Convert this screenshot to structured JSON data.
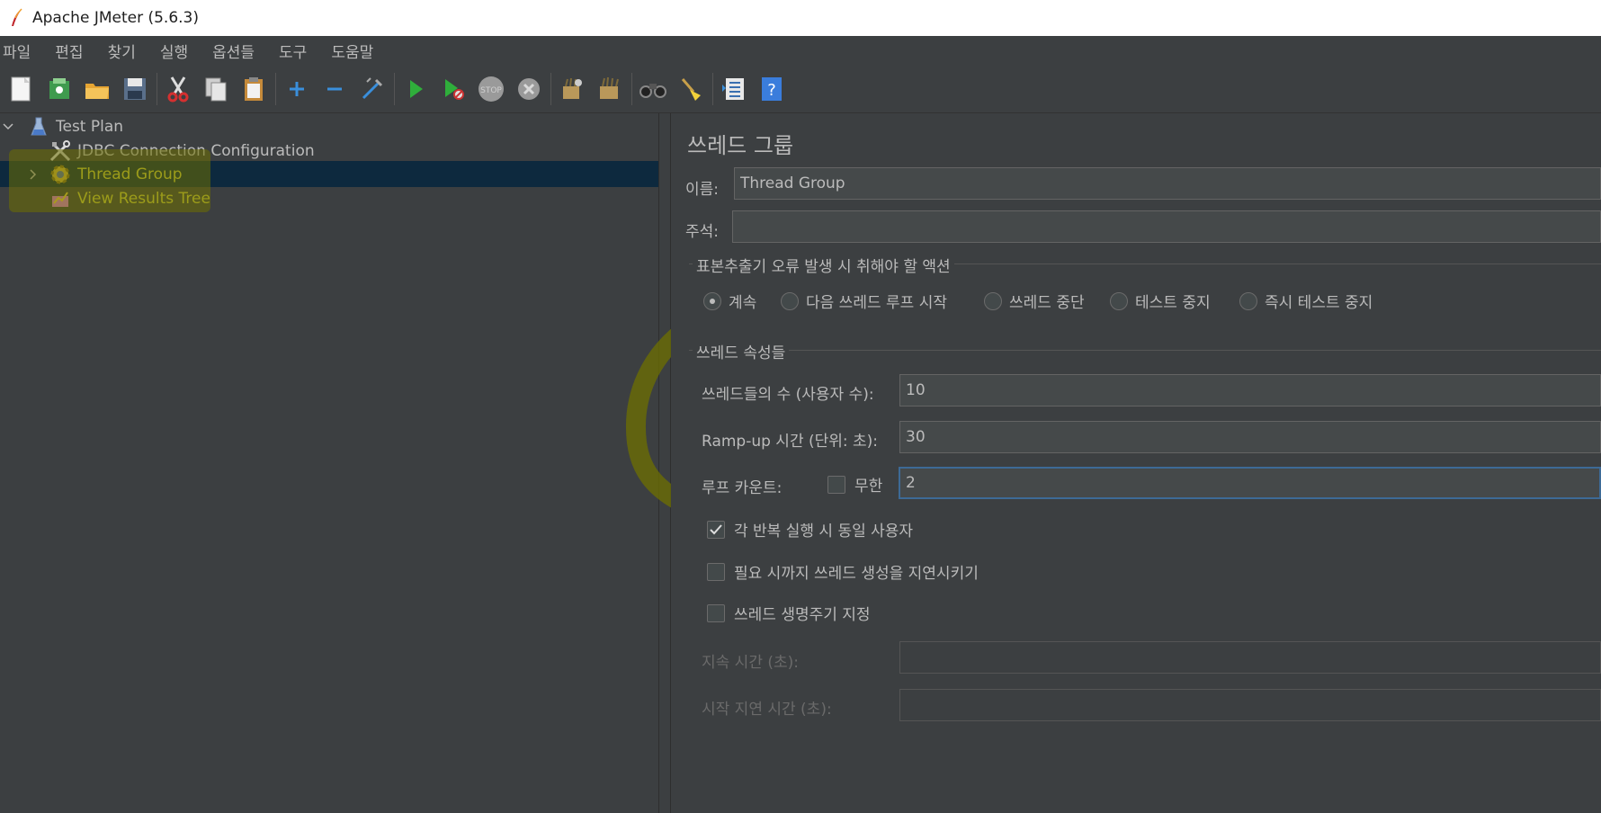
{
  "window": {
    "title": "Apache JMeter (5.6.3)"
  },
  "menu": [
    "파일",
    "편집",
    "찾기",
    "실행",
    "옵션들",
    "도구",
    "도움말"
  ],
  "toolbar": {
    "buttons": [
      "new-icon",
      "templates-icon",
      "open-icon",
      "save-icon",
      "cut-icon",
      "copy-icon",
      "paste-icon",
      "expand-icon",
      "collapse-icon",
      "toggle-icon",
      "start-icon",
      "start-no-pause-icon",
      "stop-icon",
      "shutdown-icon",
      "clear-icon",
      "clear-all-icon",
      "search-icon",
      "reset-search-icon",
      "function-helper-icon",
      "help-icon"
    ]
  },
  "tree": {
    "items": [
      {
        "label": "Test Plan",
        "level": 0,
        "expanded": true
      },
      {
        "label": "JDBC Connection Configuration",
        "level": 1
      },
      {
        "label": "Thread Group",
        "level": 1,
        "selected": true,
        "collapsed": true
      },
      {
        "label": "View Results Tree",
        "level": 1
      }
    ]
  },
  "panel": {
    "title": "쓰레드 그룹",
    "name_label": "이름:",
    "name_value": "Thread Group",
    "comment_label": "주석:",
    "comment_value": "",
    "sampler_error": {
      "title": "표본추출기 오류 발생 시 취해야 할 액션",
      "options": [
        "계속",
        "다음 쓰레드 루프 시작",
        "쓰레드 중단",
        "테스트 중지",
        "즉시 테스트 중지"
      ],
      "selected": "계속"
    },
    "thread_props": {
      "title": "쓰레드 속성들",
      "threads_label": "쓰레드들의 수 (사용자 수):",
      "threads_value": "10",
      "rampup_label": "Ramp-up 시간 (단위: 초):",
      "rampup_value": "30",
      "loop_label": "루프 카운트:",
      "infinite_label": "무한",
      "infinite_checked": false,
      "loop_value": "2",
      "same_user_label": "각 반복 실행 시 동일 사용자",
      "same_user_checked": true,
      "delay_create_label": "필요 시까지 쓰레드 생성을 지연시키기",
      "delay_create_checked": false,
      "lifetime_label": "쓰레드 생명주기 지정",
      "lifetime_checked": false,
      "duration_label": "지속 시간 (초):",
      "duration_value": "",
      "startup_delay_label": "시작 지연 시간 (초):",
      "startup_delay_value": ""
    }
  },
  "colors": {
    "background": "#3c3f41",
    "selection": "#0d293e",
    "highlight": "#d6d23a",
    "text": "#bbbbbb"
  }
}
